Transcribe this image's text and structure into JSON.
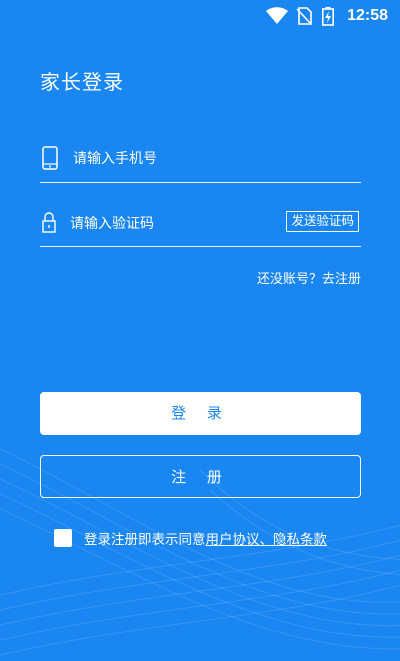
{
  "status_bar": {
    "time": "12:58",
    "icons": [
      "wifi-icon",
      "no-sim-icon",
      "battery-charging-icon"
    ]
  },
  "page": {
    "title": "家长登录"
  },
  "form": {
    "phone_placeholder": "请输入手机号",
    "code_placeholder": "请输入验证码",
    "send_code_label": "发送验证码"
  },
  "register_link": "还没账号？去注册",
  "buttons": {
    "login_label": "登 录",
    "register_label": "注 册"
  },
  "agreement": {
    "prefix": "登录注册即表示同意",
    "link": "用户协议、隐私条款",
    "checked": false
  },
  "colors": {
    "background": "#1a86f2",
    "foreground": "#ffffff"
  }
}
